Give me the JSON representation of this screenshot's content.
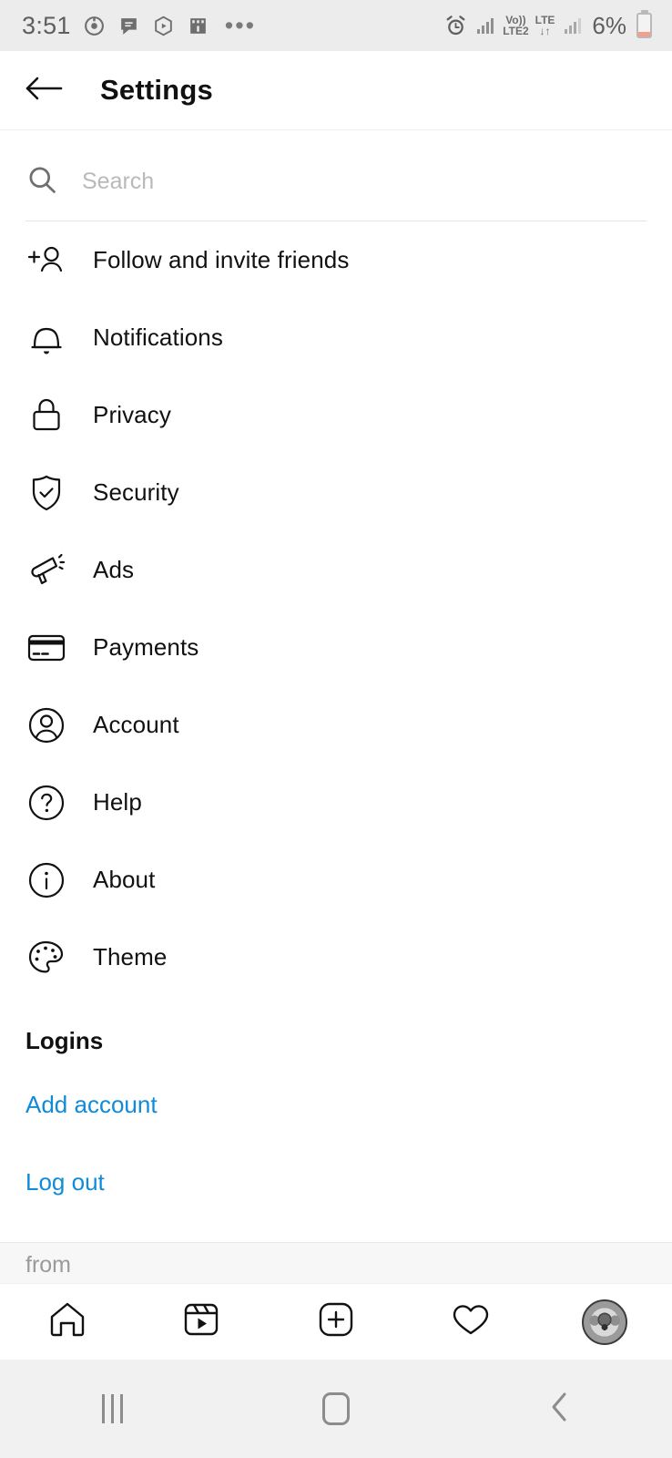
{
  "status_bar": {
    "time": "3:51",
    "left_icons": [
      "record-icon",
      "chat-bubble-icon",
      "play-badge-icon",
      "movie-clapper-icon"
    ],
    "overflow": "•••",
    "alarm_icon": "alarm-clock-icon",
    "network_badge_top": "Vo))",
    "network_badge_bottom": "LTE2",
    "data_badge_top": "LTE",
    "data_badge_bottom": "↓↑",
    "battery_percent": "6%"
  },
  "header": {
    "title": "Settings",
    "back_icon": "arrow-left-icon"
  },
  "search": {
    "placeholder": "Search",
    "value": "",
    "icon": "search-icon"
  },
  "settings_items": [
    {
      "label": "Follow and invite friends",
      "icon": "person-plus-icon"
    },
    {
      "label": "Notifications",
      "icon": "bell-icon"
    },
    {
      "label": "Privacy",
      "icon": "lock-icon"
    },
    {
      "label": "Security",
      "icon": "shield-check-icon"
    },
    {
      "label": "Ads",
      "icon": "megaphone-icon"
    },
    {
      "label": "Payments",
      "icon": "credit-card-icon"
    },
    {
      "label": "Account",
      "icon": "person-circle-icon"
    },
    {
      "label": "Help",
      "icon": "question-circle-icon"
    },
    {
      "label": "About",
      "icon": "info-circle-icon"
    },
    {
      "label": "Theme",
      "icon": "palette-icon"
    }
  ],
  "logins": {
    "section_title": "Logins",
    "add_account": "Add account",
    "log_out": "Log out",
    "link_color": "#0f8bd9"
  },
  "footer": {
    "from_text": "from"
  },
  "tab_bar": {
    "tabs": [
      {
        "name": "home",
        "icon": "home-icon"
      },
      {
        "name": "reels",
        "icon": "reels-icon"
      },
      {
        "name": "create",
        "icon": "plus-square-icon"
      },
      {
        "name": "activity",
        "icon": "heart-icon"
      },
      {
        "name": "profile",
        "icon": "avatar-icon"
      }
    ]
  },
  "android_nav": {
    "recents": "recents-icon",
    "home": "home-pill-icon",
    "back": "back-chevron-icon"
  }
}
